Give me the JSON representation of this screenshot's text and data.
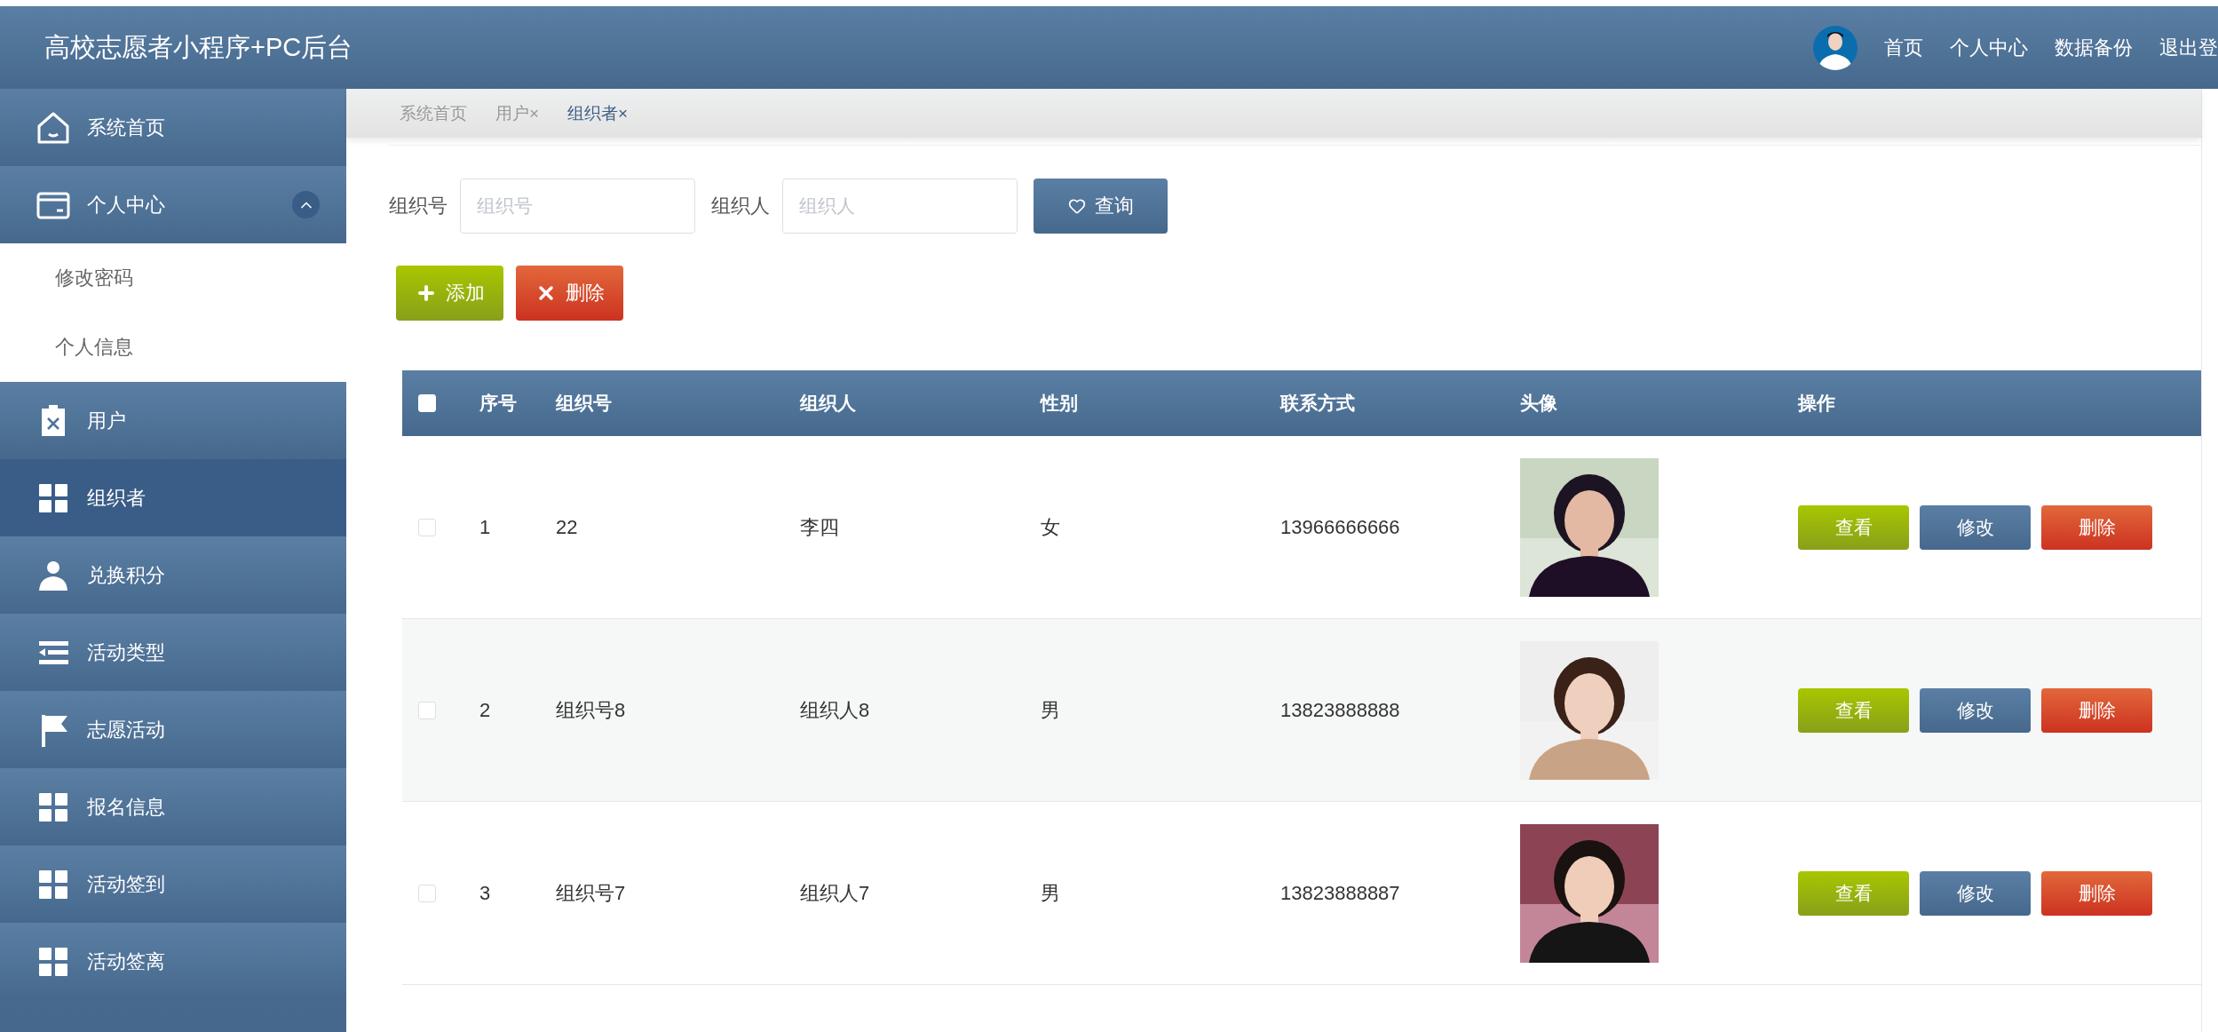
{
  "header": {
    "title": "高校志愿者小程序+PC后台",
    "nav": [
      "首页",
      "个人中心",
      "数据备份",
      "退出登"
    ]
  },
  "sidebar": {
    "items": [
      {
        "label": "系统首页",
        "selected": false
      },
      {
        "label": "个人中心",
        "selected": false,
        "expanded": true,
        "children": [
          {
            "label": "修改密码",
            "selected": false
          },
          {
            "label": "个人信息",
            "selected": false
          }
        ]
      },
      {
        "label": "用户",
        "selected": false
      },
      {
        "label": "组织者",
        "selected": true
      },
      {
        "label": "兑换积分",
        "selected": false
      },
      {
        "label": "活动类型",
        "selected": false
      },
      {
        "label": "志愿活动",
        "selected": false
      },
      {
        "label": "报名信息",
        "selected": false
      },
      {
        "label": "活动签到",
        "selected": false
      },
      {
        "label": "活动签离",
        "selected": false
      }
    ]
  },
  "tabs": [
    {
      "label": "系统首页",
      "selected": false
    },
    {
      "label": "用户",
      "close": "×",
      "selected": false
    },
    {
      "label": "组织者",
      "close": "×",
      "selected": true
    }
  ],
  "search": {
    "fields": [
      {
        "label": "组织号",
        "placeholder": "组织号"
      },
      {
        "label": "组织人",
        "placeholder": "组织人"
      }
    ],
    "button": "查询"
  },
  "actions": {
    "add": "添加",
    "delete": "删除"
  },
  "table": {
    "select_all": {
      "checked": false
    },
    "columns": [
      "序号",
      "组织号",
      "组织人",
      "性别",
      "联系方式",
      "头像",
      "操作"
    ],
    "rows": [
      {
        "checked": false,
        "index": "1",
        "org_no": "22",
        "organizer": "李四",
        "gender": "女",
        "contact": "13966666666",
        "avatar": {
          "kind": "picture"
        },
        "buttons": [
          "查看",
          "修改",
          "删除"
        ]
      },
      {
        "checked": false,
        "index": "2",
        "org_no": "组织号8",
        "organizer": "组织人8",
        "gender": "男",
        "contact": "13823888888",
        "avatar": {
          "kind": "picture"
        },
        "buttons": [
          "查看",
          "修改",
          "删除"
        ]
      },
      {
        "checked": false,
        "index": "3",
        "org_no": "组织号7",
        "organizer": "组织人7",
        "gender": "男",
        "contact": "13823888887",
        "avatar": {
          "kind": "picture"
        },
        "buttons": [
          "查看",
          "修改",
          "删除"
        ]
      }
    ]
  }
}
